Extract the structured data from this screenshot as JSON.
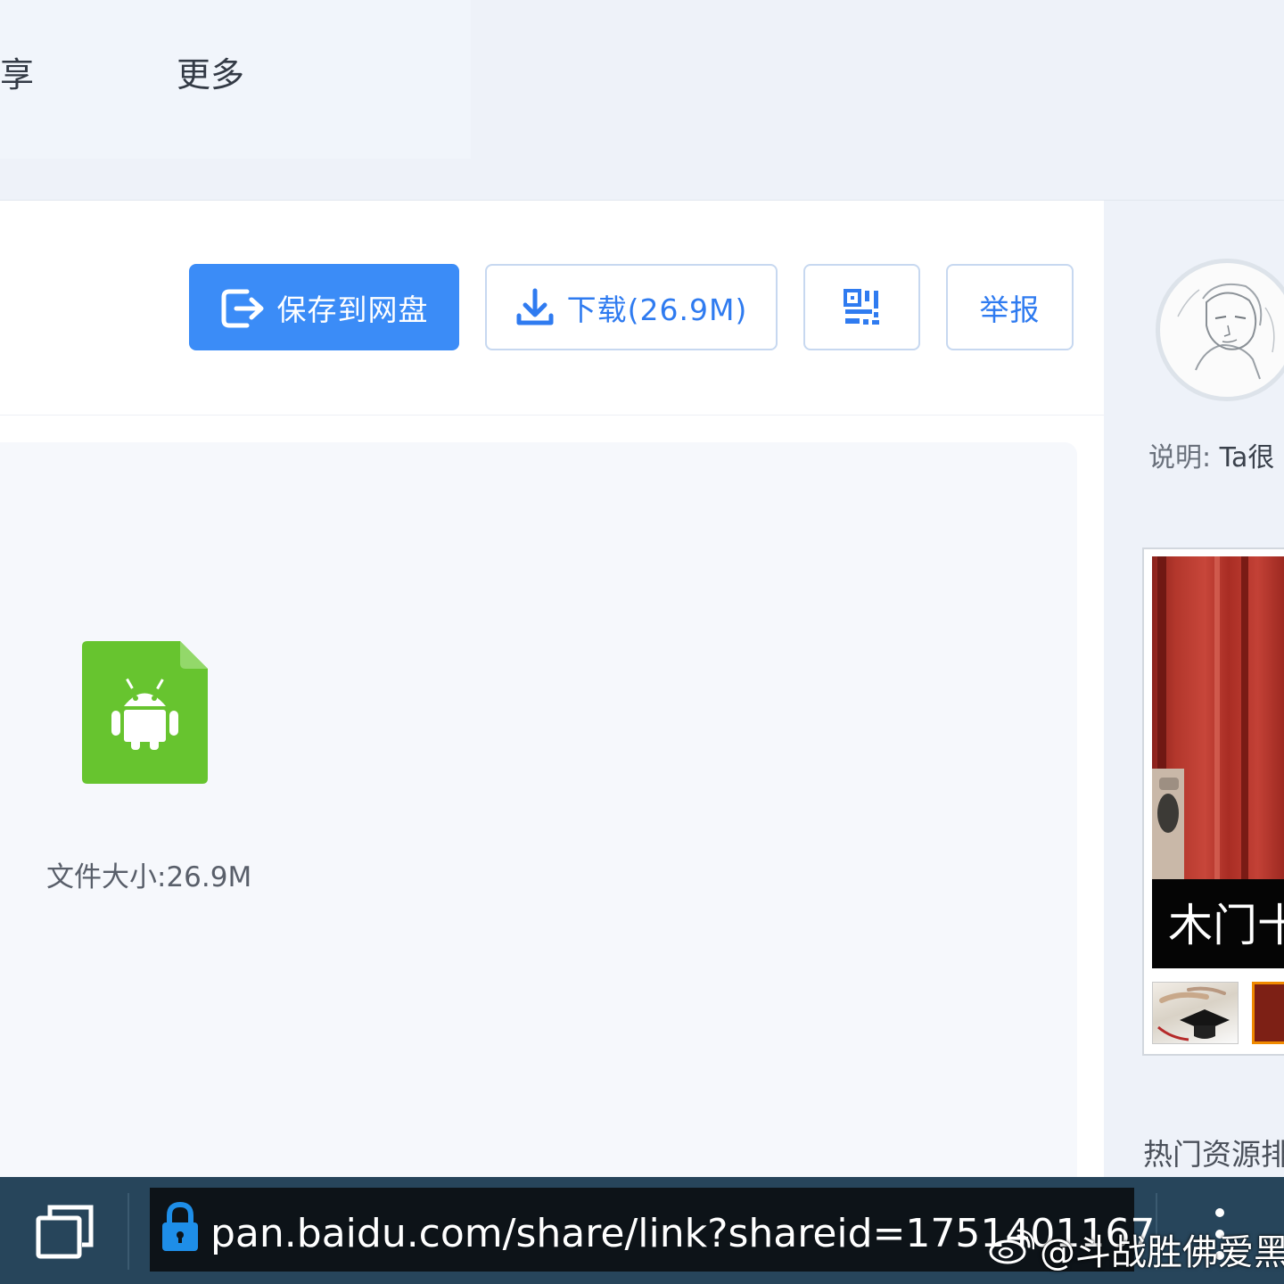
{
  "nav": {
    "items": [
      {
        "label": "享"
      },
      {
        "label": "更多"
      }
    ]
  },
  "toolbar": {
    "save_label": "保存到网盘",
    "download_label": "下载(26.9M)",
    "qr_icon": "qr-code-icon",
    "report_label": "举报"
  },
  "file": {
    "icon": "android-apk-icon",
    "icon_color": "#67c42f",
    "size_label": "文件大小:26.9M"
  },
  "sidebar": {
    "desc_label": "说明:",
    "desc_value": "Ta很",
    "ad_caption": "木门十",
    "hot_title": "热门资源排"
  },
  "browser": {
    "url": "pan.baidu.com/share/link?shareid=1751401167",
    "tabs_icon": "tabs-icon",
    "lock_icon": "lock-icon",
    "menu_icon": "more-vert-icon"
  },
  "watermark": {
    "text": "@斗战胜佛爱黑莓"
  },
  "colors": {
    "accent": "#3b8cf7",
    "bar": "#27455b"
  }
}
